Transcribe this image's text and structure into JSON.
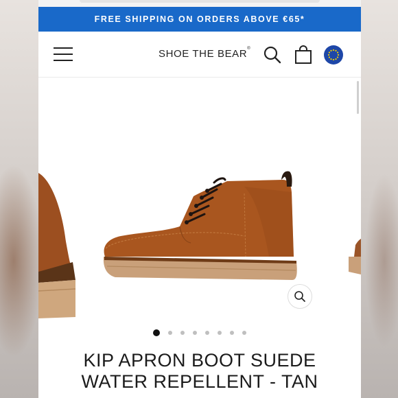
{
  "promo": {
    "text": "FREE SHIPPING ON ORDERS ABOVE €65*"
  },
  "header": {
    "brand": "SHOE THE BEAR",
    "brand_mark": "®",
    "icons": [
      "menu-icon",
      "search-icon",
      "bag-icon",
      "eu-flag-icon"
    ]
  },
  "gallery": {
    "slide_count": 8,
    "active_index": 0,
    "zoom_icon": "magnifier-icon"
  },
  "product": {
    "title_line1": "KIP APRON BOOT SUEDE",
    "title_line2": "WATER REPELLENT - TAN"
  },
  "colors": {
    "promo_bg": "#1969c9",
    "region_flag": "#1e47a8",
    "boot_suede": "#a9561f",
    "sole": "#caa27a",
    "dot_active": "#111111",
    "dot_inactive": "#bfbfbf"
  }
}
